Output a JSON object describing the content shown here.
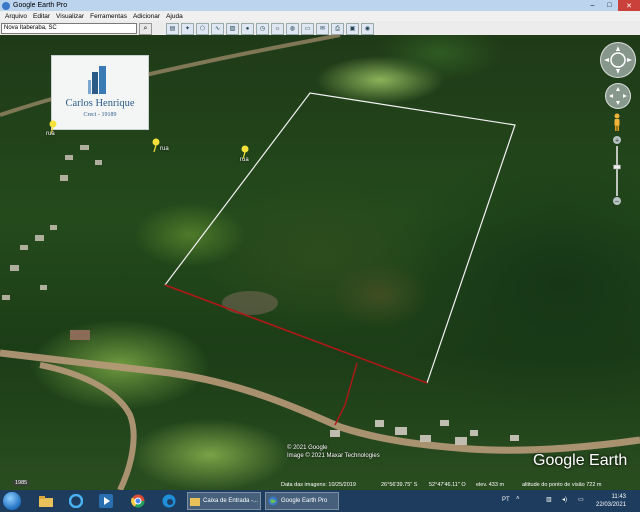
{
  "window": {
    "title": "Google Earth Pro",
    "controls": {
      "minimize": "–",
      "maximize": "□",
      "close": "✕"
    }
  },
  "menu": [
    "Arquivo",
    "Editar",
    "Visualizar",
    "Ferramentas",
    "Adicionar",
    "Ajuda"
  ],
  "search": {
    "value": "Nova Itaberaba, SC"
  },
  "toolbar_icons": [
    "sidebar-icon",
    "placemark-icon",
    "polygon-icon",
    "path-icon",
    "image-overlay-icon",
    "record-tour-icon",
    "historical-imagery-icon",
    "sun-icon",
    "planet-icon",
    "ruler-icon",
    "email-icon",
    "print-icon",
    "save-image-icon",
    "maps-icon"
  ],
  "logo": {
    "name": "Carlos Henrique",
    "creci": "Creci - 19189",
    "color": "#2a5a86"
  },
  "placemarks": [
    {
      "label": "rua"
    },
    {
      "label": "rua"
    },
    {
      "label": "rua"
    }
  ],
  "copyright": {
    "line1": "© 2021 Google",
    "line2": "Image © 2021 Maxar Technologies"
  },
  "brand": "Google Earth",
  "status": {
    "historical_year": "1985",
    "imagery_date": "Data das imagens: 10/25/2019",
    "lat": "26°56'39.75\" S",
    "lon": "52°47'46.11\" O",
    "elev": "elev.  433 m",
    "eye_alt": "altitude do ponto de visão   722 m"
  },
  "taskbar": {
    "tasks": [
      {
        "label": "Caixa de Entrada -..."
      },
      {
        "label": "Google Earth Pro"
      }
    ],
    "language": "PT",
    "time": "11:43",
    "date": "22/03/2021"
  },
  "colors": {
    "boundary_white": "#f2f2f2",
    "boundary_red": "#b01818",
    "taskbar": "#1e3d5e",
    "titlebar": "#bcd4ee"
  }
}
